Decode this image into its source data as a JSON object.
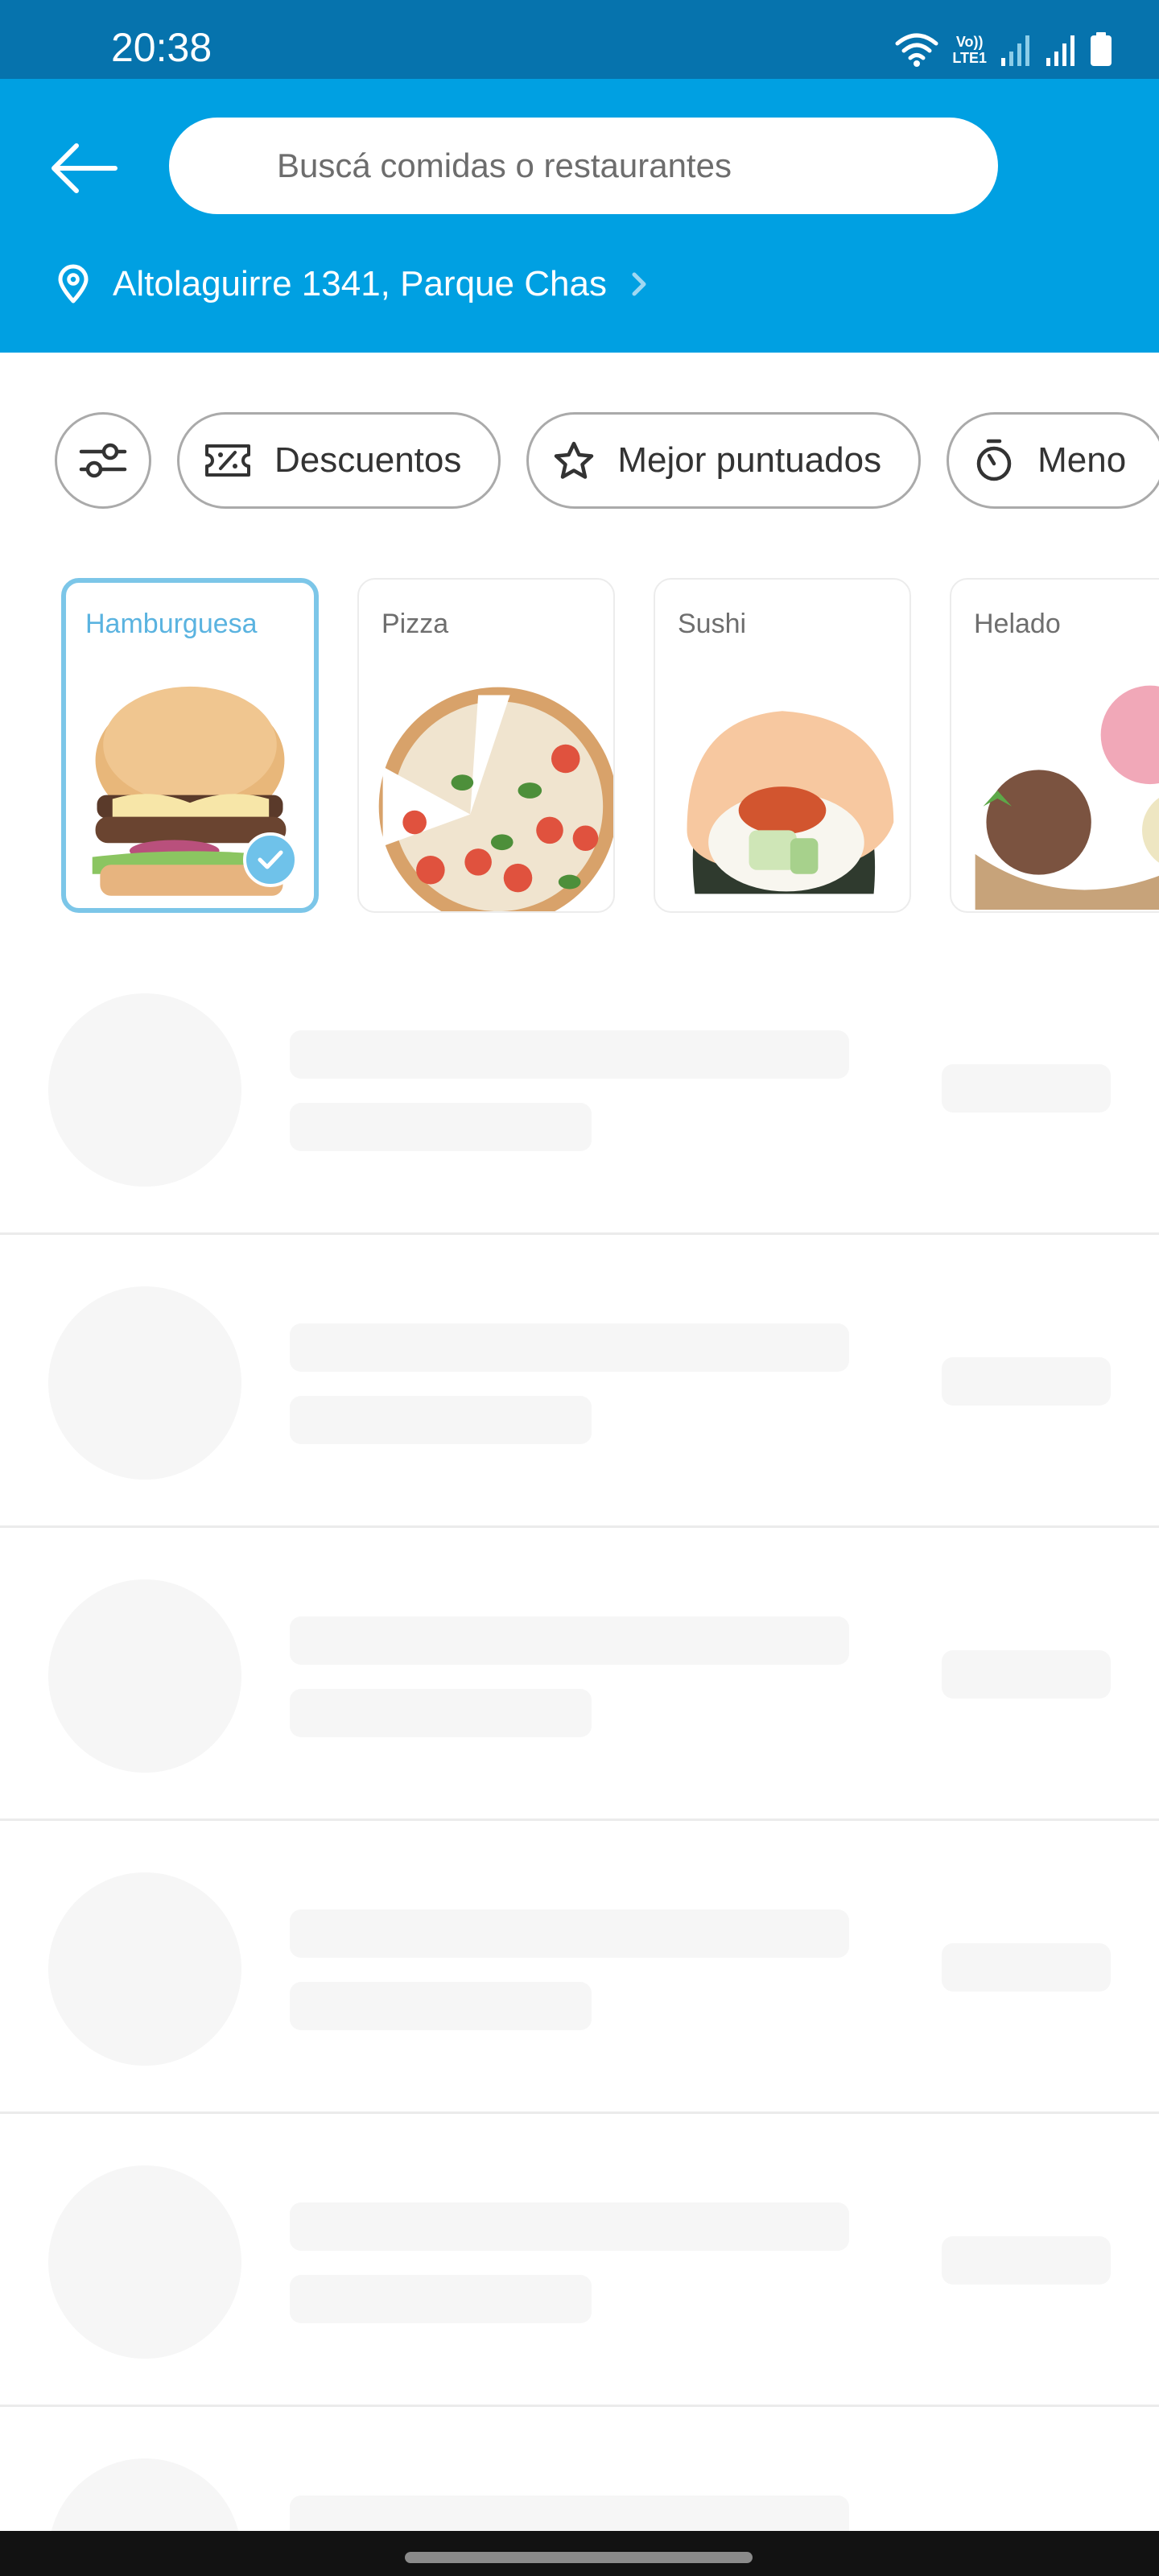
{
  "status_bar": {
    "time": "20:38",
    "volte": "Vo))",
    "lte": "LTE1"
  },
  "header": {
    "search_placeholder": "Buscá comidas o restaurantes",
    "address": "Altolaguirre 1341, Parque Chas",
    "background_color": "#00a0e2"
  },
  "filters": [
    {
      "label": "",
      "icon": "sliders-icon"
    },
    {
      "label": "Descuentos",
      "icon": "discount-ticket-icon"
    },
    {
      "label": "Mejor puntuados",
      "icon": "star-outline-icon"
    },
    {
      "label": "Meno",
      "icon": "timer-icon"
    }
  ],
  "categories": [
    {
      "label": "Hamburguesa",
      "selected": true,
      "icon": "burger-image"
    },
    {
      "label": "Pizza",
      "selected": false,
      "icon": "pizza-image"
    },
    {
      "label": "Sushi",
      "selected": false,
      "icon": "sushi-image"
    },
    {
      "label": "Helado",
      "selected": false,
      "icon": "ice-cream-image"
    }
  ],
  "accent_selected_color": "#7cc6e8"
}
